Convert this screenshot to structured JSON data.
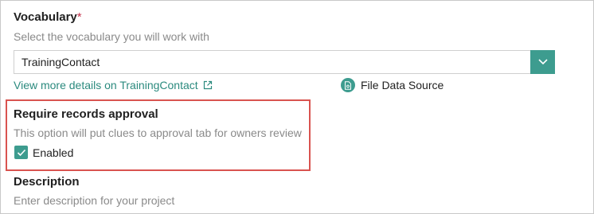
{
  "vocabulary": {
    "title": "Vocabulary",
    "required_mark": "*",
    "helper": "Select the vocabulary you will work with",
    "selected_value": "TrainingContact",
    "details_link": "View more details on TrainingContact",
    "source_label": "File Data Source",
    "source_icon": "file-data-source-icon",
    "dropdown_icon": "chevron-down-icon",
    "link_icon": "external-link-icon"
  },
  "approval": {
    "title": "Require records approval",
    "helper": "This option will put clues to approval tab for owners review",
    "checkbox_label": "Enabled",
    "checked": true
  },
  "description": {
    "title": "Description",
    "placeholder": "Enter description for your project"
  },
  "colors": {
    "accent": "#3d9c8f",
    "link": "#2b8a7e",
    "highlight": "#d9534f",
    "required": "#c4314b"
  }
}
